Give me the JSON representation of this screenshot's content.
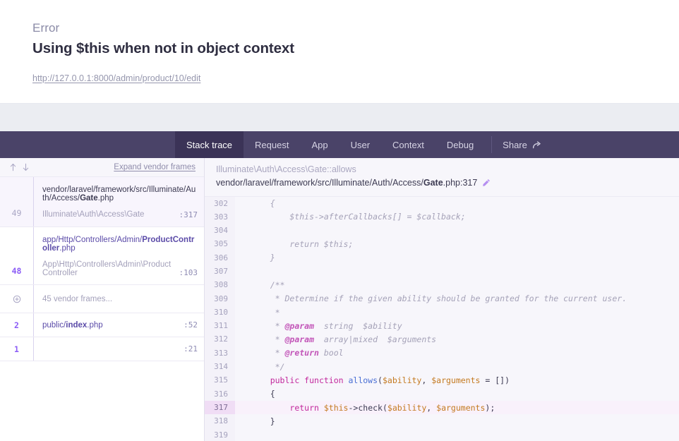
{
  "error": {
    "type": "Error",
    "message": "Using $this when not in object context",
    "url": "http://127.0.0.1:8000/admin/product/10/edit"
  },
  "nav": {
    "tabs": [
      {
        "label": "Stack trace",
        "active": true
      },
      {
        "label": "Request",
        "active": false
      },
      {
        "label": "App",
        "active": false
      },
      {
        "label": "User",
        "active": false
      },
      {
        "label": "Context",
        "active": false
      },
      {
        "label": "Debug",
        "active": false
      }
    ],
    "share_label": "Share",
    "share_icon": "share-arrow-icon",
    "active_tab_bg": "#3b3357",
    "bar_bg": "#4a4368"
  },
  "frames_panel": {
    "up_icon": "arrow-up-icon",
    "down_icon": "arrow-down-icon",
    "expand_label": "Expand vendor frames",
    "frames": [
      {
        "number": "49",
        "file_prefix": "vendor/laravel/framework/src/Illuminate/Auth/Access/",
        "file_bold": "Gate",
        "file_suffix": ".php",
        "class": "Illuminate\\Auth\\Access\\Gate",
        "line": ":317",
        "selected": true
      },
      {
        "number": "48",
        "file_prefix": "app/Http/Controllers/Admin/",
        "file_bold": "ProductController",
        "file_suffix": ".php",
        "class": "App\\Http\\Controllers\\Admin\\ProductController",
        "line": ":103",
        "selected": false
      }
    ],
    "vendor_collapsed": {
      "icon": "plus-circle-icon",
      "label": "45 vendor frames..."
    },
    "tail_frames": [
      {
        "number": "2",
        "file_prefix": "public/",
        "file_bold": "index",
        "file_suffix": ".php",
        "line": ":52"
      },
      {
        "number": "1",
        "file_prefix": "",
        "file_bold": "",
        "file_suffix": "",
        "line": ":21"
      }
    ]
  },
  "code_panel": {
    "header_class": "Illuminate\\Auth\\Access\\Gate::allows",
    "header_path_prefix": "vendor/laravel/framework/src/Illuminate/Auth/Access/",
    "header_path_bold": "Gate",
    "header_path_suffix": ".php:317",
    "edit_icon": "pencil-icon",
    "highlight_line": 317,
    "lines": [
      {
        "n": "302",
        "tokens": [
          {
            "t": "    {",
            "c": "tok-com"
          }
        ]
      },
      {
        "n": "303",
        "tokens": [
          {
            "t": "        $this->afterCallbacks[] = $callback;",
            "c": "tok-com"
          }
        ]
      },
      {
        "n": "304",
        "tokens": [
          {
            "t": "",
            "c": "tok-com"
          }
        ]
      },
      {
        "n": "305",
        "tokens": [
          {
            "t": "        return $this;",
            "c": "tok-com"
          }
        ]
      },
      {
        "n": "306",
        "tokens": [
          {
            "t": "    }",
            "c": "tok-com"
          }
        ]
      },
      {
        "n": "307",
        "tokens": [
          {
            "t": "",
            "c": "tok-com"
          }
        ]
      },
      {
        "n": "308",
        "tokens": [
          {
            "t": "    /**",
            "c": "tok-com"
          }
        ]
      },
      {
        "n": "309",
        "tokens": [
          {
            "t": "     * Determine if the given ability should be granted for the current user.",
            "c": "tok-com"
          }
        ]
      },
      {
        "n": "310",
        "tokens": [
          {
            "t": "     *",
            "c": "tok-com"
          }
        ]
      },
      {
        "n": "311",
        "tokens": [
          {
            "t": "     * ",
            "c": "tok-com"
          },
          {
            "t": "@param",
            "c": "tok-tag"
          },
          {
            "t": "  string  $ability",
            "c": "tok-com"
          }
        ]
      },
      {
        "n": "312",
        "tokens": [
          {
            "t": "     * ",
            "c": "tok-com"
          },
          {
            "t": "@param",
            "c": "tok-tag"
          },
          {
            "t": "  array|mixed  $arguments",
            "c": "tok-com"
          }
        ]
      },
      {
        "n": "313",
        "tokens": [
          {
            "t": "     * ",
            "c": "tok-com"
          },
          {
            "t": "@return",
            "c": "tok-tag"
          },
          {
            "t": " bool",
            "c": "tok-com"
          }
        ]
      },
      {
        "n": "314",
        "tokens": [
          {
            "t": "     */",
            "c": "tok-com"
          }
        ]
      },
      {
        "n": "315",
        "tokens": [
          {
            "t": "    ",
            "c": "tok-pun"
          },
          {
            "t": "public function ",
            "c": "tok-kw"
          },
          {
            "t": "allows",
            "c": "tok-fn"
          },
          {
            "t": "(",
            "c": "tok-pun"
          },
          {
            "t": "$ability",
            "c": "tok-var"
          },
          {
            "t": ", ",
            "c": "tok-pun"
          },
          {
            "t": "$arguments",
            "c": "tok-var"
          },
          {
            "t": " = [])",
            "c": "tok-pun"
          }
        ]
      },
      {
        "n": "316",
        "tokens": [
          {
            "t": "    {",
            "c": "tok-pun"
          }
        ]
      },
      {
        "n": "317",
        "tokens": [
          {
            "t": "        ",
            "c": "tok-pun"
          },
          {
            "t": "return ",
            "c": "tok-kw"
          },
          {
            "t": "$this",
            "c": "tok-var"
          },
          {
            "t": "->",
            "c": "tok-pun"
          },
          {
            "t": "check",
            "c": "tok-meth"
          },
          {
            "t": "(",
            "c": "tok-pun"
          },
          {
            "t": "$ability",
            "c": "tok-var"
          },
          {
            "t": ", ",
            "c": "tok-pun"
          },
          {
            "t": "$arguments",
            "c": "tok-var"
          },
          {
            "t": ");",
            "c": "tok-pun"
          }
        ]
      },
      {
        "n": "318",
        "tokens": [
          {
            "t": "    }",
            "c": "tok-pun"
          }
        ]
      },
      {
        "n": "319",
        "tokens": [
          {
            "t": "",
            "c": "tok-pun"
          }
        ]
      }
    ]
  }
}
